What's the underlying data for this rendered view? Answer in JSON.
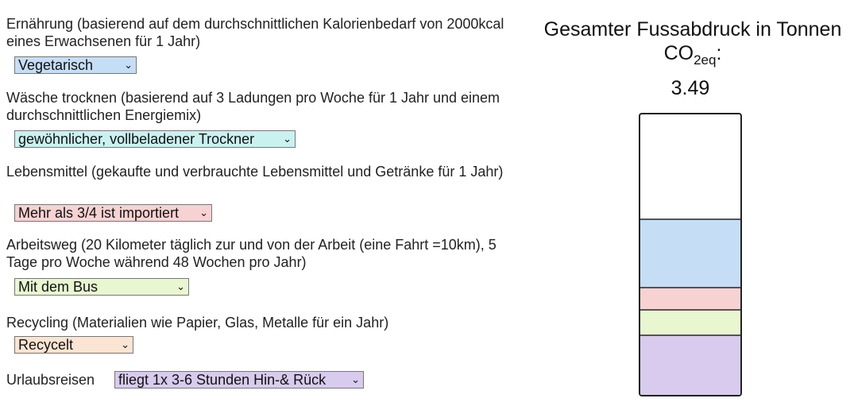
{
  "fields": [
    {
      "label": "Ernährung (basierend auf dem durchschnittlichen Kalorienbedarf von 2000kcal eines Erwachsenen für 1 Jahr)",
      "selected": "Vegetarisch",
      "color": "#c5def5"
    },
    {
      "label": "Wäsche trocknen (basierend auf 3 Ladungen pro Woche für 1 Jahr und einem durchschnittlichen Energiemix)",
      "selected": "gewöhnlicher, vollbeladener Trockner",
      "color": "#c9f1f0"
    },
    {
      "label": "Lebensmittel (gekaufte und verbrauchte Lebensmittel und Getränke für 1 Jahr)",
      "selected": "Mehr als 3/4 ist importiert",
      "color": "#f7d2d2"
    },
    {
      "label": "Arbeitsweg (20 Kilometer täglich zur und von der Arbeit (eine Fahrt =10km), 5 Tage pro Woche während 48 Wochen pro Jahr)",
      "selected": "Mit dem Bus",
      "color": "#e9f7d0"
    },
    {
      "label": "Recycling (Materialien wie Papier, Glas, Metalle für ein Jahr)",
      "selected": "Recycelt",
      "color": "#fbe4d2"
    },
    {
      "label": "Urlaubsreisen",
      "selected": "fliegt 1x 3-6 Stunden Hin-& Rück",
      "color": "#d8cbed"
    }
  ],
  "summary": {
    "title_text": "Gesamter Fussabdruck in Tonnen",
    "co2": "CO",
    "co2_sub": "2eq",
    "co2_colon": ":",
    "total": "3.49"
  },
  "footprint_bar": {
    "segments": [
      {
        "name": "Ernährung",
        "color": "#c5def5",
        "fraction": 0.245
      },
      {
        "name": "Lebensmittel",
        "color": "#f7d2d2",
        "fraction": 0.08
      },
      {
        "name": "Arbeitsweg",
        "color": "#e9f7d0",
        "fraction": 0.09
      },
      {
        "name": "Urlaubsreisen",
        "color": "#d8cbed",
        "fraction": 0.215
      }
    ]
  }
}
